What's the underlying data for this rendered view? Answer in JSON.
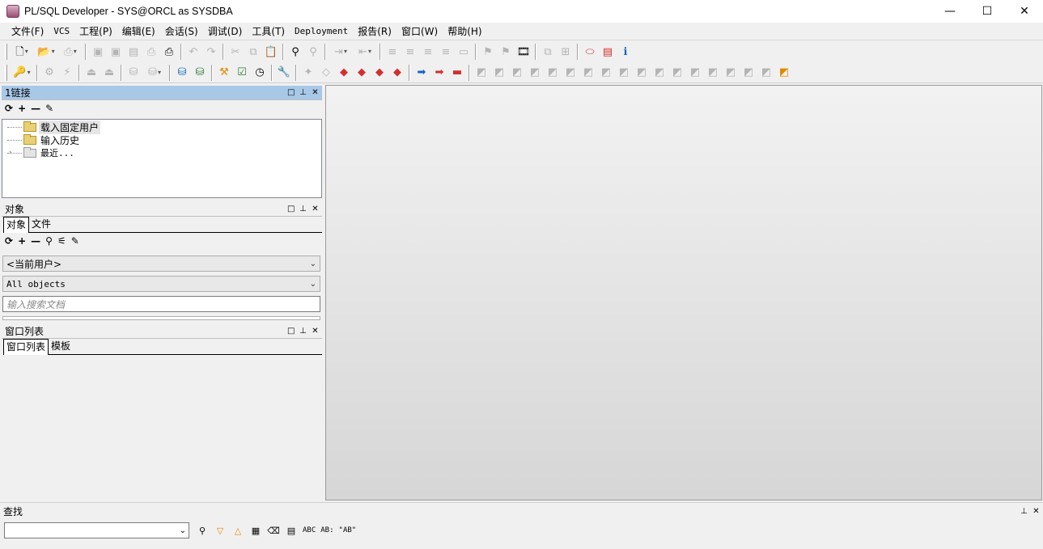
{
  "window": {
    "title": "PL/SQL Developer - SYS@ORCL as SYSDBA",
    "min_glyph": "—",
    "max_glyph": "☐",
    "close_glyph": "✕"
  },
  "menu": [
    "文件(F)",
    "VCS",
    "工程(P)",
    "编辑(E)",
    "会话(S)",
    "调试(D)",
    "工具(T)",
    "Deployment",
    "报告(R)",
    "窗口(W)",
    "帮助(H)"
  ],
  "connections_panel": {
    "title": "1链接",
    "tree": [
      {
        "label": "载入固定用户",
        "selected": true
      },
      {
        "label": "输入历史",
        "selected": false
      },
      {
        "label": "最近...",
        "selected": false,
        "expandable": true
      }
    ]
  },
  "objects_panel": {
    "title": "对象",
    "tabs": [
      "对象",
      "文件"
    ],
    "user_combo": "<当前用户>",
    "type_combo": "All objects",
    "search_placeholder": "输入搜索文档"
  },
  "window_list_panel": {
    "title": "窗口列表",
    "tabs": [
      "窗口列表",
      "模板"
    ]
  },
  "find_bar": {
    "title": "查找",
    "input_value": "",
    "tools": [
      "ABC",
      "AB:",
      "\"AB\""
    ]
  },
  "panel_buttons": [
    "□",
    "⊥",
    "✕"
  ]
}
